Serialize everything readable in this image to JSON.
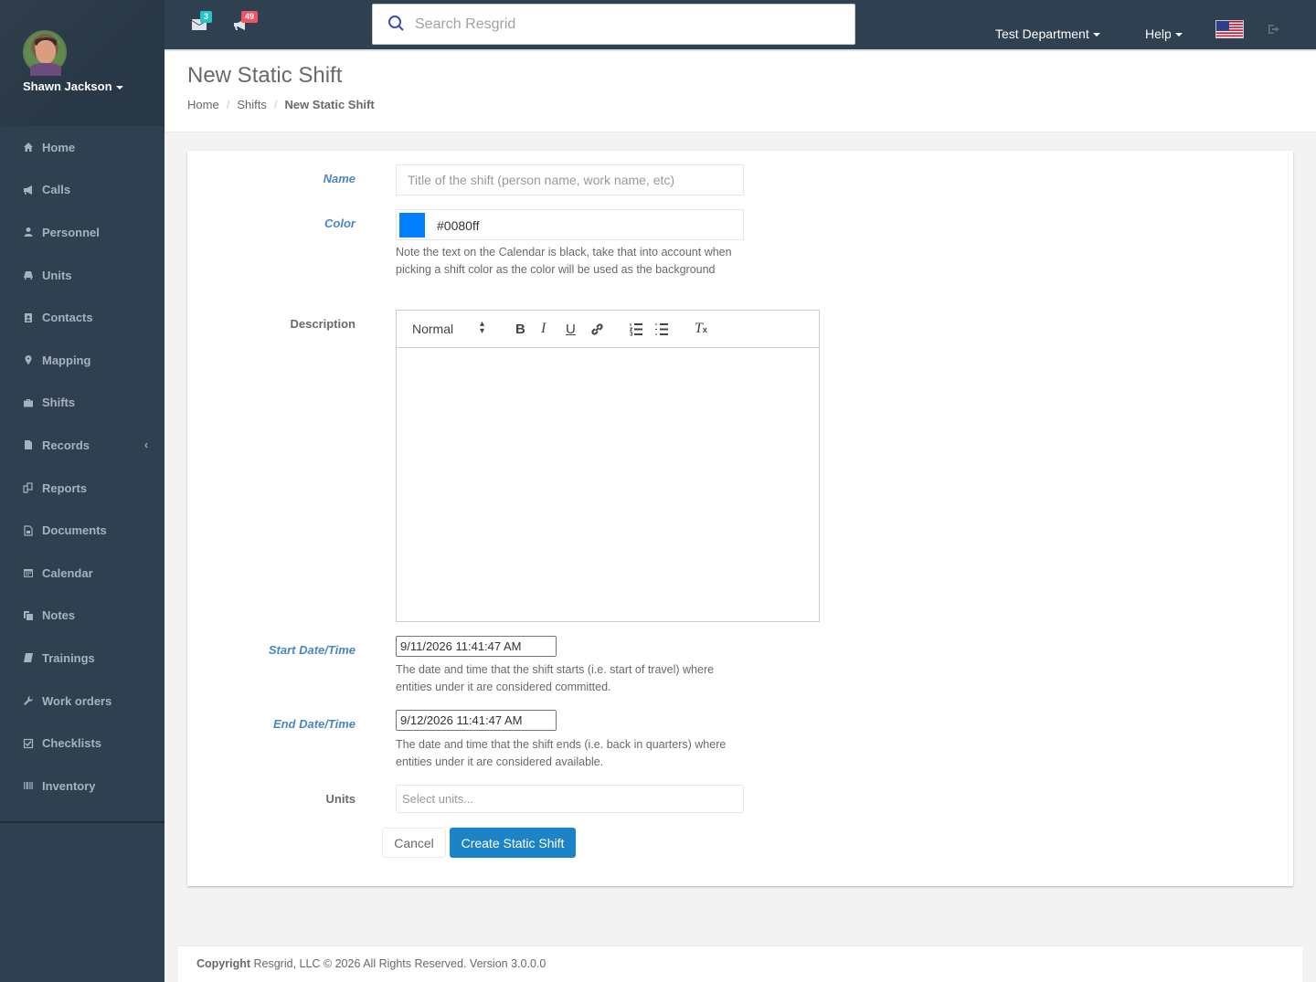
{
  "user": {
    "name": "Shawn Jackson"
  },
  "nav": [
    {
      "label": "Home",
      "icon": "home-icon"
    },
    {
      "label": "Calls",
      "icon": "bullhorn-icon"
    },
    {
      "label": "Personnel",
      "icon": "user-icon"
    },
    {
      "label": "Units",
      "icon": "truck-icon"
    },
    {
      "label": "Contacts",
      "icon": "contact-book-icon"
    },
    {
      "label": "Mapping",
      "icon": "map-marker-icon"
    },
    {
      "label": "Shifts",
      "icon": "briefcase-icon"
    },
    {
      "label": "Records",
      "icon": "file-icon"
    },
    {
      "label": "Reports",
      "icon": "reports-icon"
    },
    {
      "label": "Documents",
      "icon": "document-icon"
    },
    {
      "label": "Calendar",
      "icon": "calendar-icon"
    },
    {
      "label": "Notes",
      "icon": "notes-icon"
    },
    {
      "label": "Trainings",
      "icon": "book-icon"
    },
    {
      "label": "Work orders",
      "icon": "wrench-icon"
    },
    {
      "label": "Checklists",
      "icon": "check-square-icon"
    },
    {
      "label": "Inventory",
      "icon": "barcode-icon"
    }
  ],
  "topbar": {
    "messages_count": "3",
    "calls_count": "49",
    "search_placeholder": "Search Resgrid",
    "department": "Test Department",
    "help": "Help",
    "colors": {
      "messages_badge": "#23c6c8",
      "calls_badge": "#ed5565"
    }
  },
  "heading": {
    "title": "New Static Shift",
    "breadcrumb": [
      "Home",
      "Shifts",
      "New Static Shift"
    ]
  },
  "form": {
    "name": {
      "label": "Name",
      "placeholder": "Title of the shift (person name, work name, etc)"
    },
    "color": {
      "label": "Color",
      "value": "#0080ff",
      "help": "Note the text on the Calendar is black, take that into account when picking a shift color as the color will be used as the background"
    },
    "description": {
      "label": "Description",
      "format": "Normal"
    },
    "start": {
      "label": "Start Date/Time",
      "value": "9/11/2026 11:41:47 AM",
      "help": "The date and time that the shift starts (i.e. start of travel) where entities under it are considered committed."
    },
    "end": {
      "label": "End Date/Time",
      "value": "9/12/2026 11:41:47 AM",
      "help": "The date and time that the shift ends (i.e. back in quarters) where entities under it are considered available."
    },
    "units": {
      "label": "Units",
      "placeholder": "Select units..."
    },
    "cancel": "Cancel",
    "submit": "Create Static Shift"
  },
  "footer": {
    "copyright": "Copyright",
    "text": " Resgrid, LLC © 2026 All Rights Reserved. ",
    "version": "Version 3.0.0.0"
  }
}
